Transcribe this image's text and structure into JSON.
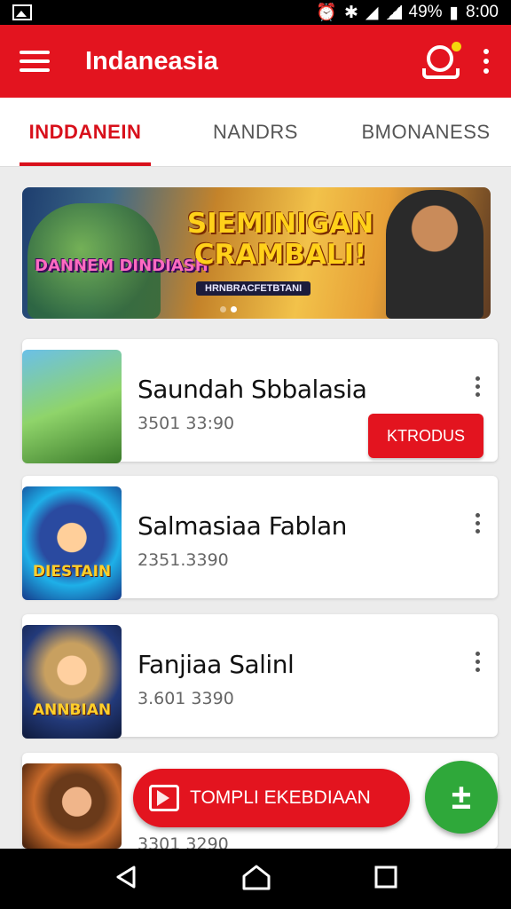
{
  "status_bar": {
    "battery": "49%",
    "time": "8:00"
  },
  "app_bar": {
    "title": "Indaneasia"
  },
  "tabs": [
    {
      "label": "INDDANEIN",
      "active": true
    },
    {
      "label": "NANDRS",
      "active": false
    },
    {
      "label": "BMONANESS",
      "active": false
    }
  ],
  "banner": {
    "left_logo": "DANNEM DINDIASH",
    "headline": "SIEMINIGAN CRAMBALI!",
    "tagline": "HRNBRACFETBTANI",
    "page_count": 2,
    "active_page": 2
  },
  "games": [
    {
      "name": "Saundah Sbbalasia",
      "meta": "3501 33:90",
      "action": "KTRODUS",
      "thumb_label": ""
    },
    {
      "name": "Salmasiaa Fablan",
      "meta": "2351.3390",
      "action": "",
      "thumb_label": "DIESTAIN"
    },
    {
      "name": "Fanjiaa Salinl",
      "meta": "3.601 3390",
      "action": "",
      "thumb_label": "ANNBIAN"
    },
    {
      "name": "",
      "meta": "3301 3290",
      "action": "",
      "thumb_label": ""
    }
  ],
  "fab_extended": {
    "label": "TOMPLI EKEBDIAAN"
  },
  "fab": {
    "symbol": "±"
  }
}
